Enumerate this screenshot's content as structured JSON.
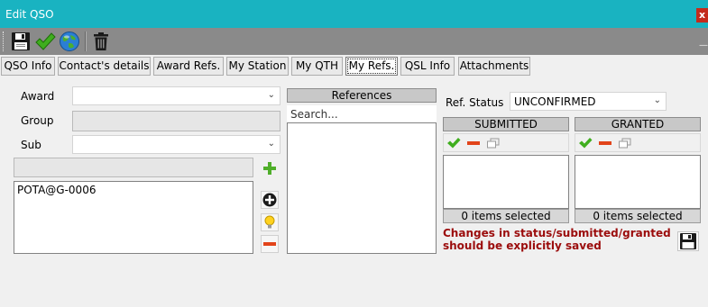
{
  "window": {
    "title": "Edit QSO",
    "close_label": "x"
  },
  "toolbar": {
    "buttons": [
      {
        "name": "save-icon"
      },
      {
        "name": "checkmark-icon"
      },
      {
        "name": "globe-icon"
      },
      {
        "name": "trash-icon"
      }
    ]
  },
  "tabs": [
    {
      "label": "QSO Info",
      "active": false
    },
    {
      "label": "Contact's details",
      "active": false
    },
    {
      "label": "Award Refs.",
      "active": false
    },
    {
      "label": "My Station",
      "active": false
    },
    {
      "label": "My QTH",
      "active": false
    },
    {
      "label": "My Refs.",
      "active": true
    },
    {
      "label": "QSL Info",
      "active": false
    },
    {
      "label": "Attachments",
      "active": false
    }
  ],
  "form": {
    "award_label": "Award",
    "award_value": "",
    "group_label": "Group",
    "group_value": "",
    "sub_label": "Sub",
    "sub_value": "",
    "refs_list": [
      "POTA@G-0006"
    ]
  },
  "references": {
    "header": "References",
    "search_placeholder": "Search..."
  },
  "ref_status": {
    "label": "Ref. Status",
    "value": "UNCONFIRMED"
  },
  "submitted": {
    "header": "SUBMITTED",
    "status": "0 items selected"
  },
  "granted": {
    "header": "GRANTED",
    "status": "0 items selected"
  },
  "warning": "Changes in status/submitted/granted should be explicitly saved",
  "colors": {
    "titlebar": "#19b3c1",
    "toolbar": "#8a8a8a",
    "warning": "#9b0c0c",
    "close": "#c42b1c"
  }
}
